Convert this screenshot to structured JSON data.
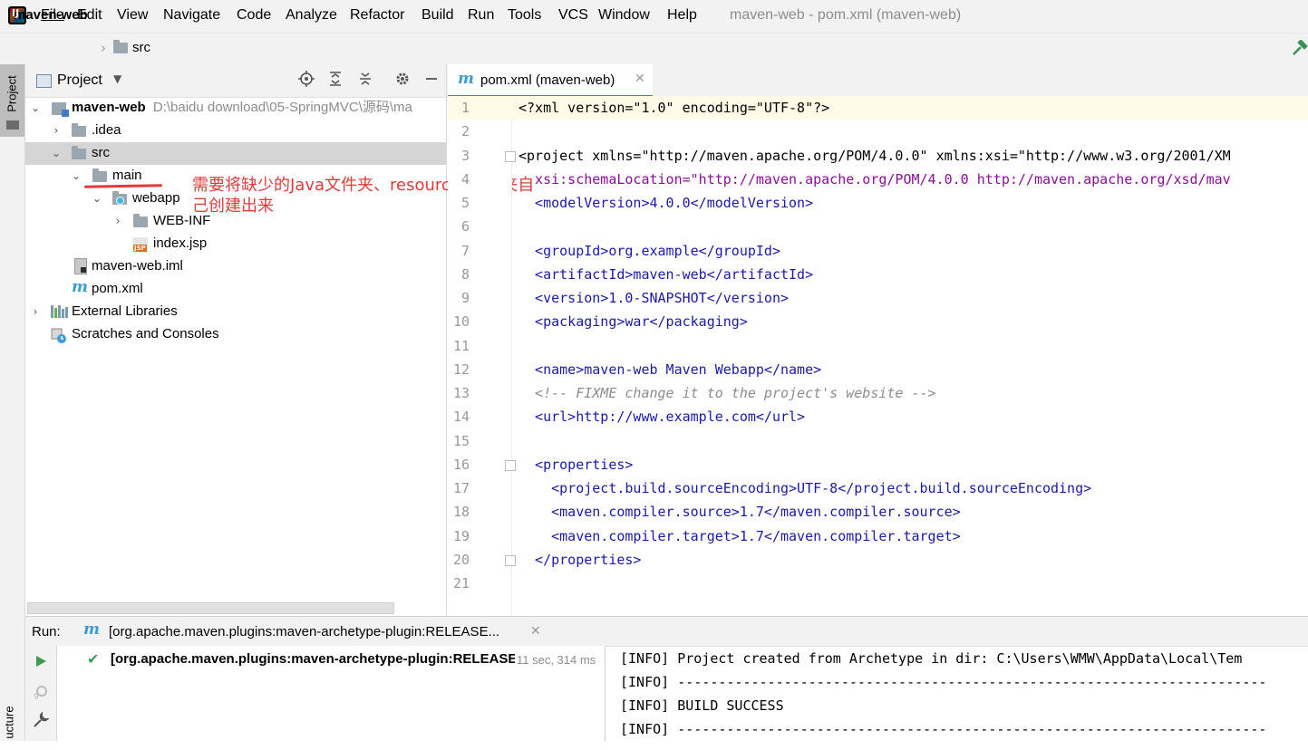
{
  "menu": {
    "items": [
      "File",
      "Edit",
      "View",
      "Navigate",
      "Code",
      "Analyze",
      "Refactor",
      "Build",
      "Run",
      "Tools",
      "VCS",
      "Window",
      "Help"
    ],
    "window_title": "maven-web - pom.xml (maven-web)"
  },
  "navbar": {
    "project": "maven-web",
    "separator": "›",
    "folder": "src"
  },
  "left_strip": {
    "project_label": "Project",
    "structure_label": "ucture"
  },
  "project_panel": {
    "title": "Project",
    "tree": {
      "root_name": "maven-web",
      "root_path": "D:\\baidu download\\05-SpringMVC\\源码\\ma",
      "idea": ".idea",
      "src": "src",
      "main": "main",
      "webapp": "webapp",
      "webinf": "WEB-INF",
      "index": "index.jsp",
      "iml": "maven-web.iml",
      "pom": "pom.xml",
      "libs": "External Libraries",
      "scratches": "Scratches and Consoles"
    },
    "annotation": "需要将缺少的Java文件夹、resources文件夹自己创建出来"
  },
  "editor": {
    "tab_label": "pom.xml (maven-web)",
    "line_numbers": [
      "1",
      "2",
      "3",
      "4",
      "5",
      "6",
      "7",
      "8",
      "9",
      "10",
      "11",
      "12",
      "13",
      "14",
      "15",
      "16",
      "17",
      "18",
      "19",
      "20",
      "21"
    ],
    "code": {
      "l1": "<?xml version=\"1.0\" encoding=\"UTF-8\"?>",
      "l3": "<project xmlns=\"http://maven.apache.org/POM/4.0.0\" xmlns:xsi=\"http://www.w3.org/2001/XM",
      "l4": "  xsi:schemaLocation=\"http://maven.apache.org/POM/4.0.0 http://maven.apache.org/xsd/mav",
      "l5": "  <modelVersion>4.0.0</modelVersion>",
      "l7": "  <groupId>org.example</groupId>",
      "l8": "  <artifactId>maven-web</artifactId>",
      "l9": "  <version>1.0-SNAPSHOT</version>",
      "l10": "  <packaging>war</packaging>",
      "l12": "  <name>maven-web Maven Webapp</name>",
      "l13": "  <!-- FIXME change it to the project's website -->",
      "l14": "  <url>http://www.example.com</url>",
      "l16": "  <properties>",
      "l17": "    <project.build.sourceEncoding>UTF-8</project.build.sourceEncoding>",
      "l18": "    <maven.compiler.source>1.7</maven.compiler.source>",
      "l19": "    <maven.compiler.target>1.7</maven.compiler.target>",
      "l20": "  </properties>"
    }
  },
  "run": {
    "label": "Run:",
    "tab": "[org.apache.maven.plugins:maven-archetype-plugin:RELEASE...",
    "item": "[org.apache.maven.plugins:maven-archetype-plugin:RELEASE",
    "time": "11 sec, 314 ms",
    "console": [
      "[INFO] Project created from Archetype in dir: C:\\Users\\WMW\\AppData\\Local\\Tem",
      "[INFO] ------------------------------------------------------------------------",
      "[INFO] BUILD SUCCESS",
      "[INFO] ------------------------------------------------------------------------"
    ]
  }
}
